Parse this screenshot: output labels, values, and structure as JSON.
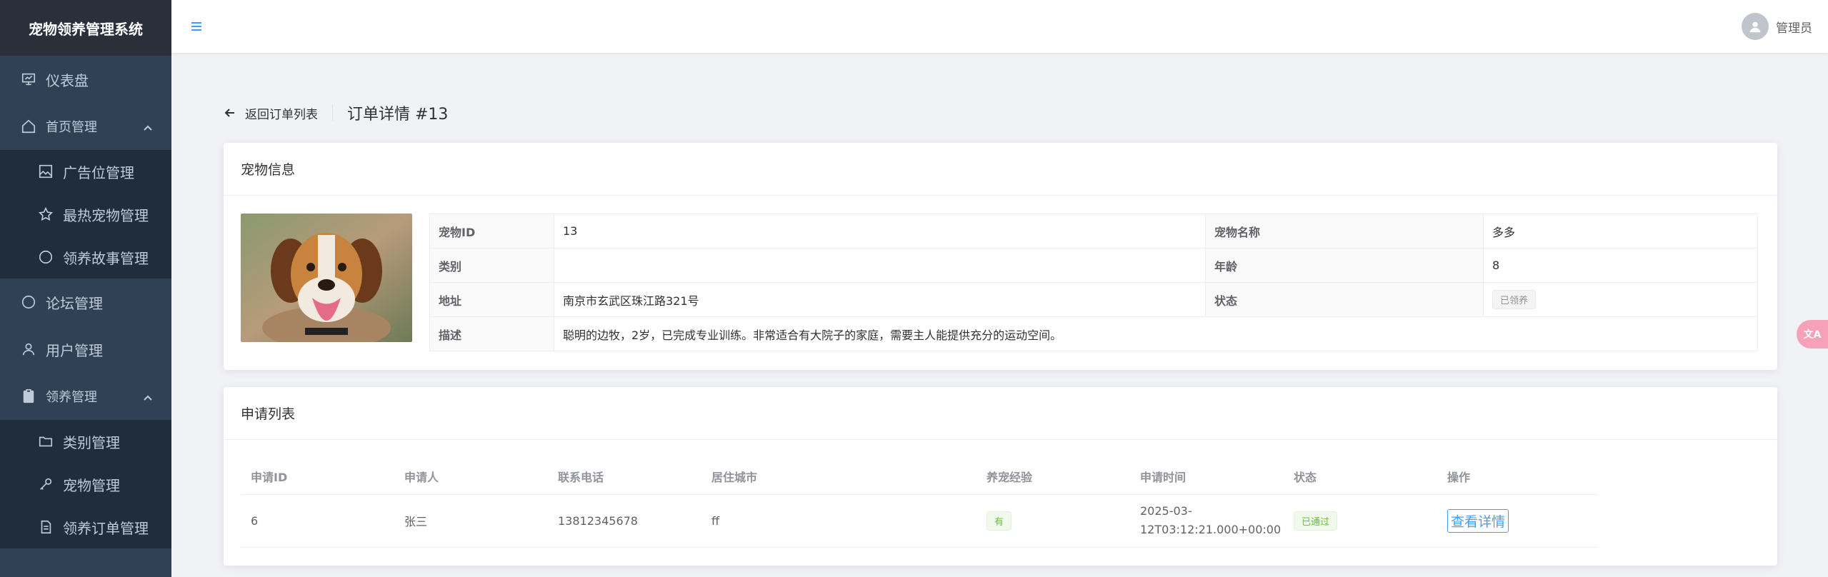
{
  "app": {
    "title": "宠物领养管理系统"
  },
  "sidebar": {
    "items": [
      {
        "label": "仪表盘"
      },
      {
        "label": "首页管理"
      },
      {
        "label": "广告位管理"
      },
      {
        "label": "最热宠物管理"
      },
      {
        "label": "领养故事管理"
      },
      {
        "label": "论坛管理"
      },
      {
        "label": "用户管理"
      },
      {
        "label": "领养管理"
      },
      {
        "label": "类别管理"
      },
      {
        "label": "宠物管理"
      },
      {
        "label": "领养订单管理"
      }
    ]
  },
  "header": {
    "user": "管理员"
  },
  "page": {
    "back_label": "返回订单列表",
    "title": "订单详情 #13"
  },
  "pet": {
    "card_title": "宠物信息",
    "rows": [
      {
        "l1": "宠物ID",
        "v1": "13",
        "l2": "宠物名称",
        "v2": "多多"
      },
      {
        "l1": "类别",
        "v1": "",
        "l2": "年龄",
        "v2": "8"
      },
      {
        "l1": "地址",
        "v1": "南京市玄武区珠江路321号",
        "l2": "状态",
        "v2": "已领养"
      },
      {
        "l1": "描述",
        "v1": "聪明的边牧，2岁，已完成专业训练。非常适合有大院子的家庭，需要主人能提供充分的运动空间。"
      }
    ]
  },
  "applications": {
    "card_title": "申请列表",
    "columns": [
      "申请ID",
      "申请人",
      "联系电话",
      "居住城市",
      "养宠经验",
      "申请时间",
      "状态",
      "操作"
    ],
    "rows": [
      {
        "id": "6",
        "applicant": "张三",
        "phone": "13812345678",
        "city": "ff",
        "experience": "有",
        "time_line1": "2025-03-",
        "time_line2": "12T03:12:21.000+00:00",
        "status": "已通过",
        "action": "查看详情"
      }
    ]
  },
  "colors": {
    "sidebar_bg": "#304156",
    "accent": "#409eff",
    "success": "#67c23a"
  },
  "float": {
    "label": "文A"
  }
}
